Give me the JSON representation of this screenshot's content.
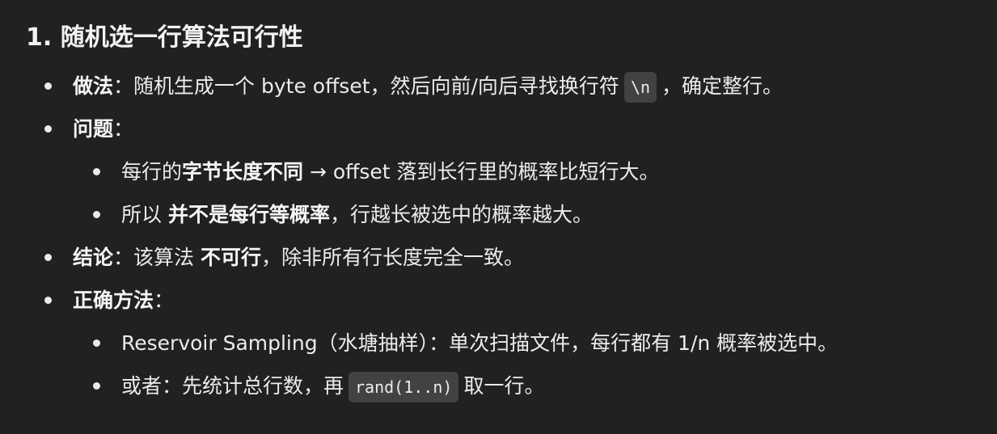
{
  "heading": "1. 随机选一行算法可行性",
  "method": {
    "label": "做法",
    "colon": "：",
    "text_before_code": "随机生成一个 byte offset，然后向前/向后寻找换行符",
    "code": "\\n",
    "text_after_code": "，确定整行。"
  },
  "problem": {
    "label": "问题",
    "colon": "：",
    "sub1": {
      "prefix": "每行的",
      "bold": "字节长度不同",
      "suffix": " → offset 落到长行里的概率比短行大。"
    },
    "sub2": {
      "prefix": "所以 ",
      "bold": "并不是每行等概率",
      "suffix": "，行越长被选中的概率越大。"
    }
  },
  "conclusion": {
    "label": "结论",
    "colon": "：",
    "prefix": "该算法 ",
    "bold": "不可行",
    "suffix": "，除非所有行长度完全一致。"
  },
  "correct": {
    "label": "正确方法",
    "colon": "：",
    "sub1": "Reservoir Sampling（水塘抽样）：单次扫描文件，每行都有 1/n 概率被选中。",
    "sub2": {
      "prefix": "或者：先统计总行数，再",
      "code": "rand(1..n)",
      "suffix": "取一行。"
    }
  }
}
